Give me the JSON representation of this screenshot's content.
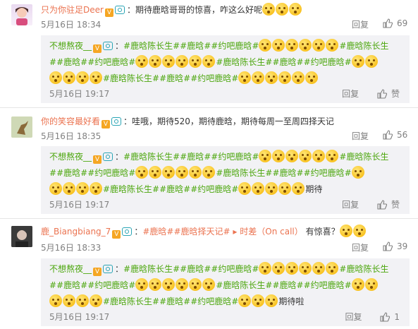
{
  "comments": [
    {
      "user": "只为你驻足Deer",
      "text_prefix": "：期待鹿晗哥哥的惊喜，咋这么好呢",
      "time": "5月16日 18:34",
      "reply": "回复",
      "likes": "69",
      "sub": {
        "user": "不想熬夜__",
        "line1_tags": [
          "#鹿晗陈长生#",
          "#鹿晗#",
          "#约吧鹿晗#"
        ],
        "line1_tail": "#鹿晗陈长生",
        "line2_head": "#",
        "line2_tags": [
          "#鹿晗#",
          "#约吧鹿晗#"
        ],
        "line2_mid": [
          "#鹿晗陈长生#",
          "#鹿晗#",
          "#约吧鹿晗#"
        ],
        "line3_tags": [
          "#鹿晗陈长生#",
          "#鹿晗#",
          "#约吧鹿晗#"
        ],
        "time": "5月16日 19:17",
        "reply": "回复",
        "like": "赞"
      }
    },
    {
      "user": "你的笑容最好看",
      "text": "：哇哦，期待520，期待鹿晗，期待每周一至周四择天记",
      "time": "5月16日 18:35",
      "reply": "回复",
      "likes": "56",
      "sub": {
        "user": "不想熬夜__",
        "tail_text": "期待",
        "time": "5月16日 19:17",
        "reply": "回复",
        "like": "赞"
      }
    },
    {
      "user": "鹿_Biangbiang_7",
      "tags": [
        "#鹿晗#",
        "#鹿晗择天记#"
      ],
      "link_text": "时差（On call）",
      "after_link": "有惊喜？",
      "time": "5月16日 18:33",
      "reply": "回复",
      "likes": "39",
      "sub": {
        "user": "不想熬夜__",
        "tail_text": "期待啦",
        "time": "5月16日 19:17",
        "reply": "回复",
        "likes": "1"
      }
    }
  ],
  "colors": {
    "accent": "#eb7350",
    "green_tag": "#4ba60c",
    "subbg": "#f2f2f5",
    "meta": "#808080"
  }
}
